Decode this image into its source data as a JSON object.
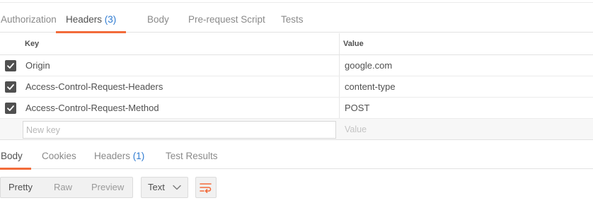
{
  "request_tabs": [
    {
      "label": "Authorization",
      "count": ""
    },
    {
      "label": "Headers",
      "count": "(3)"
    },
    {
      "label": "Body",
      "count": ""
    },
    {
      "label": "Pre-request Script",
      "count": ""
    },
    {
      "label": "Tests",
      "count": ""
    }
  ],
  "active_request_tab": "Headers",
  "headers_table": {
    "columns": {
      "key": "Key",
      "value": "Value"
    },
    "rows": [
      {
        "checked": true,
        "key": "Origin",
        "value": "google.com"
      },
      {
        "checked": true,
        "key": "Access-Control-Request-Headers",
        "value": "content-type"
      },
      {
        "checked": true,
        "key": "Access-Control-Request-Method",
        "value": "POST"
      }
    ],
    "new_row": {
      "key_placeholder": "New key",
      "value_placeholder": "Value"
    }
  },
  "response_tabs": [
    {
      "label": "Body",
      "count": ""
    },
    {
      "label": "Cookies",
      "count": ""
    },
    {
      "label": "Headers",
      "count": "(1)"
    },
    {
      "label": "Test Results",
      "count": ""
    }
  ],
  "active_response_tab": "Body",
  "toolbar": {
    "view_modes": [
      "Pretty",
      "Raw",
      "Preview"
    ],
    "active_view_mode": "Pretty",
    "format_select": "Text",
    "wrap_icon": "wrap-lines-icon"
  },
  "colors": {
    "accent": "#f26b3a",
    "count_blue": "#2f7bd1",
    "checkbox": "#505050"
  },
  "icons": {
    "checkbox": "checkmark-icon",
    "select": "chevron-down-icon",
    "wrap": "wrap-lines-icon"
  }
}
